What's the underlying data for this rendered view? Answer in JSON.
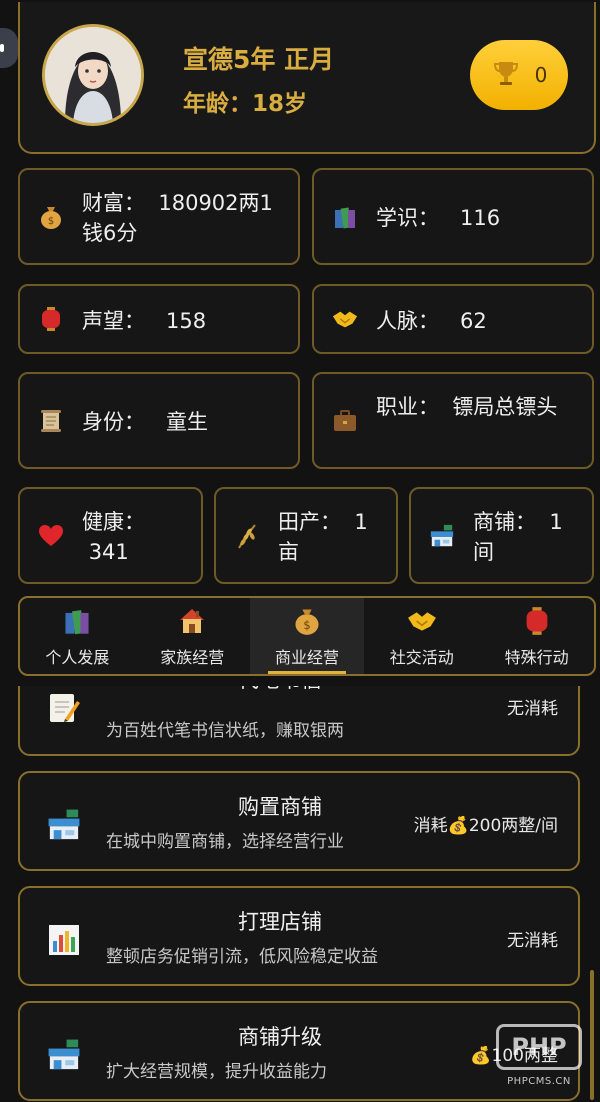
{
  "header": {
    "date": "宣德5年 正月",
    "age_label": "年龄：",
    "age_value": "18岁",
    "trophy_count": "0"
  },
  "stats": {
    "wealth": {
      "label": "财富：",
      "value": "180902两1钱6分"
    },
    "knowledge": {
      "label": "学识：",
      "value": "116"
    },
    "prestige": {
      "label": "声望：",
      "value": "158"
    },
    "connections": {
      "label": "人脉：",
      "value": "62"
    },
    "identity": {
      "label": "身份：",
      "value": "童生"
    },
    "occupation": {
      "label": "职业：",
      "value": "镖局总镖头"
    },
    "health": {
      "label": "健康：",
      "value": "341"
    },
    "farmland": {
      "label": "田产：",
      "value": "1亩"
    },
    "shops": {
      "label": "商铺：",
      "value": "1间"
    }
  },
  "tabs": [
    {
      "label": "个人发展",
      "icon": "books-icon"
    },
    {
      "label": "家族经营",
      "icon": "house-icon"
    },
    {
      "label": "商业经营",
      "icon": "money-bag-icon",
      "active": true
    },
    {
      "label": "社交活动",
      "icon": "handshake-icon"
    },
    {
      "label": "特殊行动",
      "icon": "lantern-icon"
    }
  ],
  "actions": [
    {
      "title": "代笔书信",
      "desc": "为百姓代笔书信状纸，赚取银两",
      "cost": "无消耗",
      "icon": "memo-icon"
    },
    {
      "title": "购置商铺",
      "desc": "在城中购置商铺，选择经营行业",
      "cost": "消耗💰200两整/间",
      "icon": "store-icon"
    },
    {
      "title": "打理店铺",
      "desc": "整顿店务促销引流，低风险稳定收益",
      "cost": "无消耗",
      "icon": "bar-chart-icon"
    },
    {
      "title": "商铺升级",
      "desc": "扩大经营规模，提升收益能力",
      "cost": "💰100两整",
      "icon": "store-icon"
    }
  ],
  "watermark": {
    "logo": "PHP",
    "text": "PHPCMS.CN"
  },
  "colors": {
    "gold": "#d9ad3f",
    "border": "#8a6f2c",
    "background": "#121212"
  }
}
